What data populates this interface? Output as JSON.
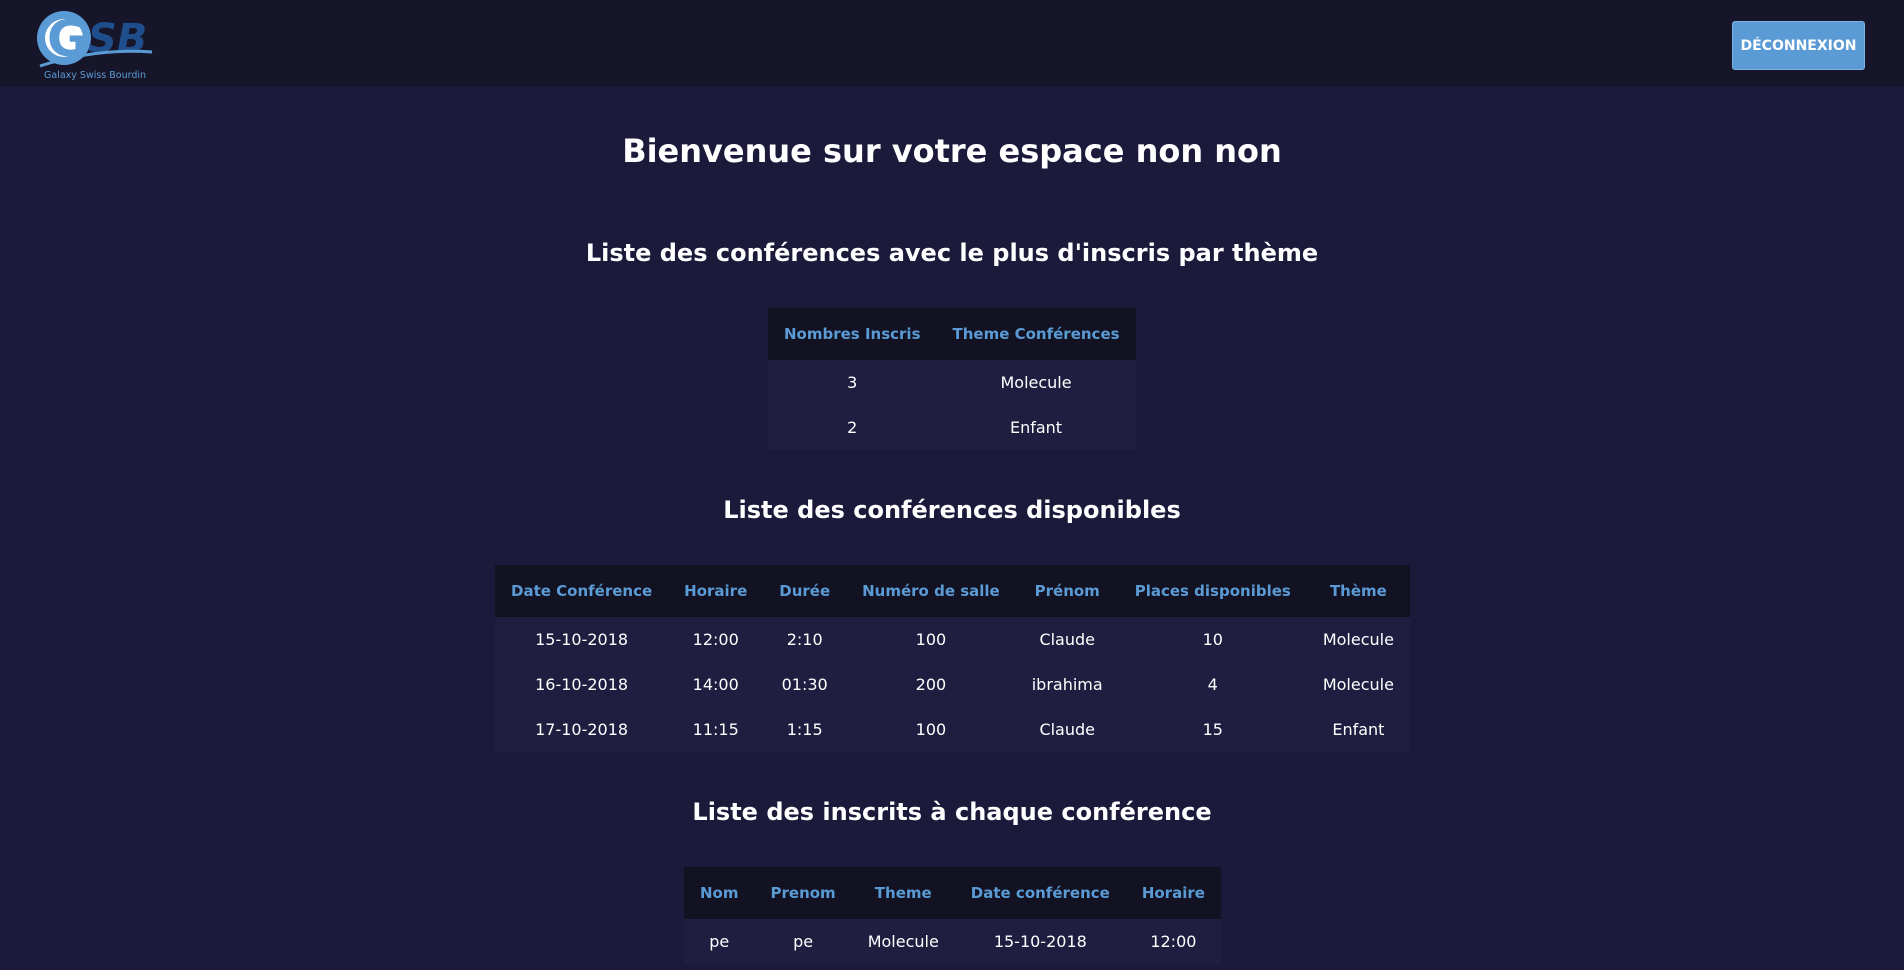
{
  "header": {
    "logo_letters": "GSB",
    "logo_caption": "Galaxy Swiss Bourdin",
    "logout_label": "DÉCONNEXION"
  },
  "main": {
    "welcome": "Bienvenue sur votre espace non non",
    "section_top": {
      "title": "Liste des conférences avec le plus d'inscris par thème",
      "columns": [
        "Nombres Inscris",
        "Theme Conférences"
      ],
      "rows": [
        [
          "3",
          "Molecule"
        ],
        [
          "2",
          "Enfant"
        ]
      ]
    },
    "section_available": {
      "title": "Liste des conférences disponibles",
      "columns": [
        "Date Conférence",
        "Horaire",
        "Durée",
        "Numéro de salle",
        "Prénom",
        "Places disponibles",
        "Thème"
      ],
      "rows": [
        [
          "15-10-2018",
          "12:00",
          "2:10",
          "100",
          "Claude",
          "10",
          "Molecule"
        ],
        [
          "16-10-2018",
          "14:00",
          "01:30",
          "200",
          "ibrahima",
          "4",
          "Molecule"
        ],
        [
          "17-10-2018",
          "11:15",
          "1:15",
          "100",
          "Claude",
          "15",
          "Enfant"
        ]
      ]
    },
    "section_registered": {
      "title": "Liste des inscrits à chaque conférence",
      "columns": [
        "Nom",
        "Prenom",
        "Theme",
        "Date conférence",
        "Horaire"
      ],
      "rows": [
        [
          "pe",
          "pe",
          "Molecule",
          "15-10-2018",
          "12:00"
        ]
      ]
    }
  },
  "colors": {
    "background": "#1b1a3b",
    "topbar": "#16152a",
    "accent": "#5b9bd5",
    "table_header_bg": "#121222",
    "table_row_bg": "#1f1e40"
  }
}
